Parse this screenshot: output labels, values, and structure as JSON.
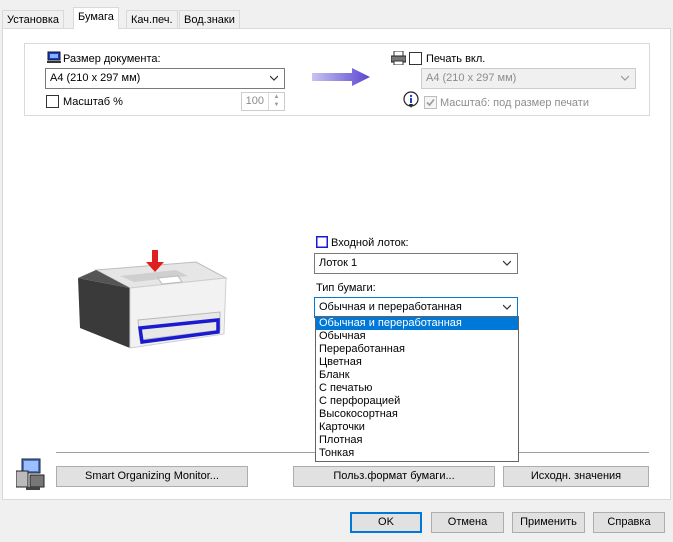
{
  "tabs": [
    {
      "label": "Установка"
    },
    {
      "label": "Бумага"
    },
    {
      "label": "Кач.печ."
    },
    {
      "label": "Вод.знаки"
    }
  ],
  "document": {
    "size_label": "Размер документа:",
    "size_value": "A4 (210 x 297 мм)",
    "scale_label": "Масштаб %",
    "scale_value": "100"
  },
  "print_on": {
    "label": "Печать вкл.",
    "value": "A4 (210 x 297 мм)",
    "fit_label": "Масштаб: под размер печати"
  },
  "tray": {
    "label": "Входной лоток:",
    "value": "Лоток 1"
  },
  "paper_type": {
    "label": "Тип бумаги:",
    "value": "Обычная и переработанная",
    "options": [
      "Обычная и переработанная",
      "Обычная",
      "Переработанная",
      "Цветная",
      "Бланк",
      "С печатью",
      "С перфорацией",
      "Высокосортная",
      "Карточки",
      "Плотная",
      "Тонкая"
    ]
  },
  "buttons": {
    "smart_monitor": "Smart Organizing Monitor...",
    "custom_paper": "Польз.формат бумаги...",
    "defaults": "Исходн. значения",
    "ok": "OK",
    "cancel": "Отмена",
    "apply": "Применить",
    "help": "Справка"
  },
  "colors": {
    "accent": "#0078d7",
    "arrow": "#6a5acd",
    "printer_red": "#e02020"
  }
}
